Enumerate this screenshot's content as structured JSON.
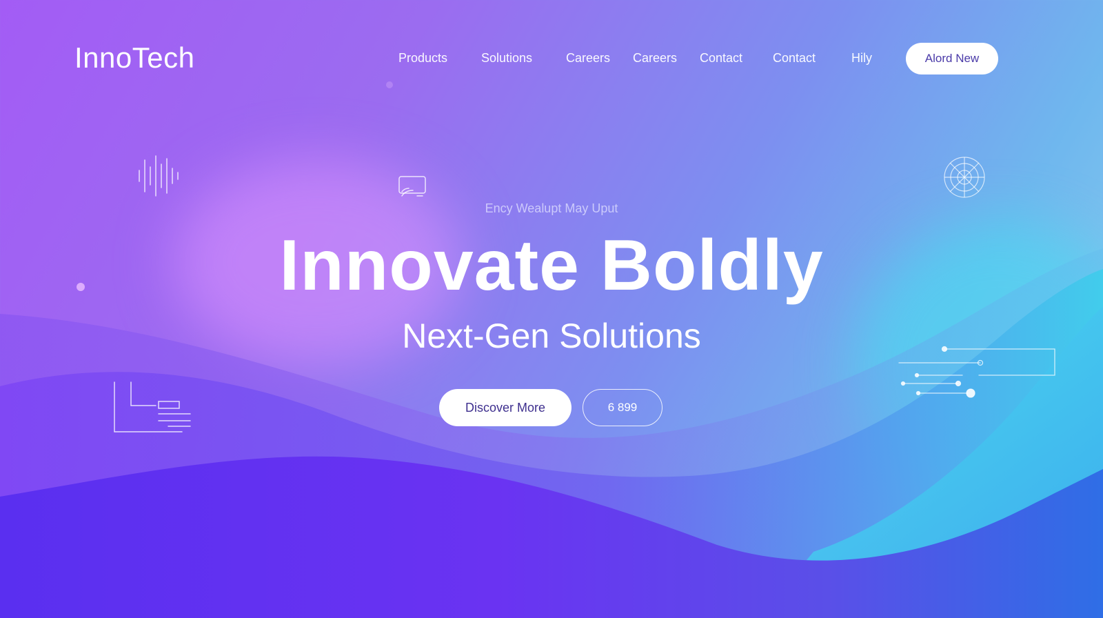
{
  "brand": {
    "logo_text": "InnoTech"
  },
  "nav": {
    "items": [
      {
        "label": "Products"
      },
      {
        "label": "Solutions"
      },
      {
        "label": "Careers"
      },
      {
        "label": "Careers"
      },
      {
        "label": "Contact"
      },
      {
        "label": "Contact"
      },
      {
        "label": "Hily"
      }
    ],
    "cta_label": "Alord New"
  },
  "hero": {
    "eyebrow": "Ency Wealupt May Uput",
    "title": "Innovate Boldly",
    "subtitle": "Next-Gen Solutions",
    "primary_button": "Discover More",
    "secondary_button": "6 899"
  },
  "icons": {
    "top_left": "sound-wave-icon",
    "top_center": "screen-cast-icon",
    "top_right": "network-globe-icon",
    "bottom_left": "chart-lines-icon",
    "right": "circuit-lines-icon"
  },
  "colors": {
    "gradient_start": "#a35cf5",
    "gradient_mid": "#7d8ff0",
    "gradient_end": "#8fd3f0",
    "wave_deep": "#5a2ff0",
    "wave_cyan": "#3fd8ee",
    "button_text": "#3e2f8e"
  }
}
